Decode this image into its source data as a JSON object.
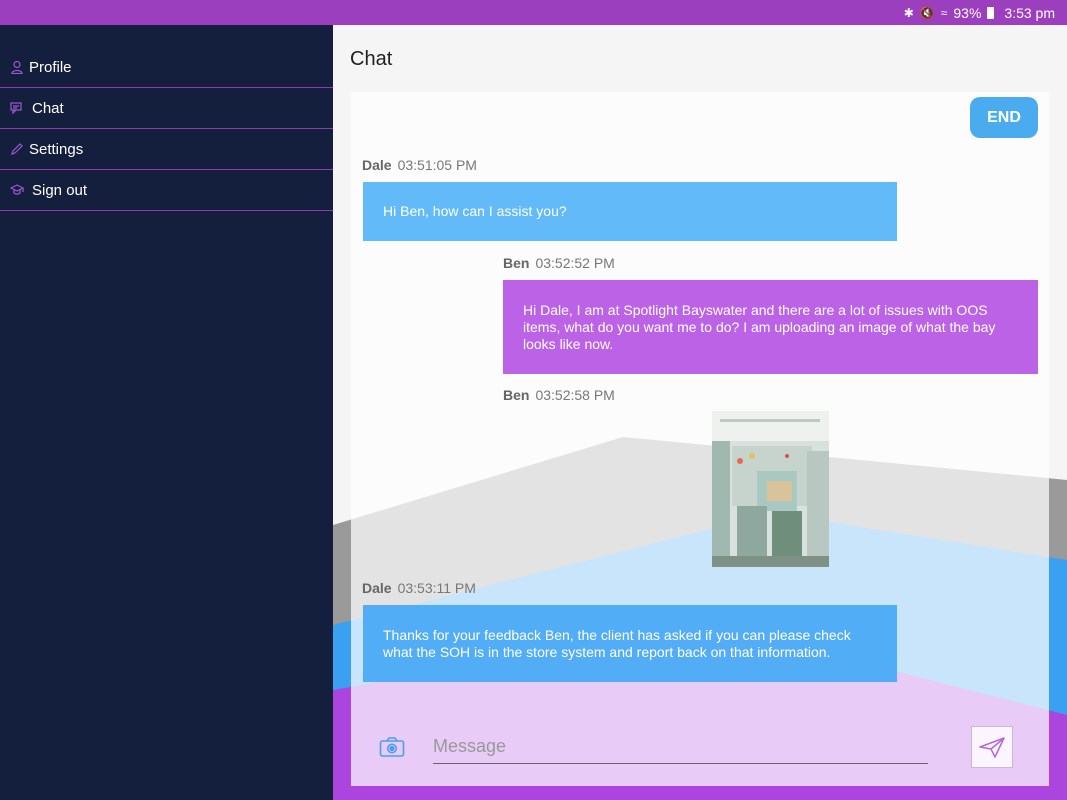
{
  "status_bar": {
    "battery": "93%",
    "time": "3:53 pm"
  },
  "sidebar": {
    "items": [
      {
        "label": "Profile",
        "icon": "user-icon"
      },
      {
        "label": "Chat",
        "icon": "chat-icon"
      },
      {
        "label": "Settings",
        "icon": "pencil-icon"
      },
      {
        "label": "Sign out",
        "icon": "graduation-cap-icon"
      }
    ]
  },
  "chat": {
    "title": "Chat",
    "end_label": "END",
    "messages": [
      {
        "sender": "Dale",
        "time": "03:51:05 PM",
        "text": "Hi Ben, how can I assist you?"
      },
      {
        "sender": "Ben",
        "time": "03:52:52 PM",
        "text": "Hi Dale, I am at Spotlight Bayswater and there are a lot of issues with OOS items, what do you want me to do? I am uploading an image of what the bay looks like now."
      },
      {
        "sender": "Ben",
        "time": "03:52:58 PM",
        "text": ""
      },
      {
        "sender": "Dale",
        "time": "03:53:11 PM",
        "text": "Thanks for your feedback Ben, the client has asked if you can please check what the SOH is in the store system and report back on that information."
      }
    ],
    "composer": {
      "placeholder": "Message",
      "value": ""
    }
  },
  "colors": {
    "status_bar": "#9c3fbf",
    "sidebar": "#141e3d",
    "divider": "#8d3ab4",
    "bubble_blue": "#62baf8",
    "bubble_purple": "#bc62e6",
    "end_button": "#4aacef"
  }
}
